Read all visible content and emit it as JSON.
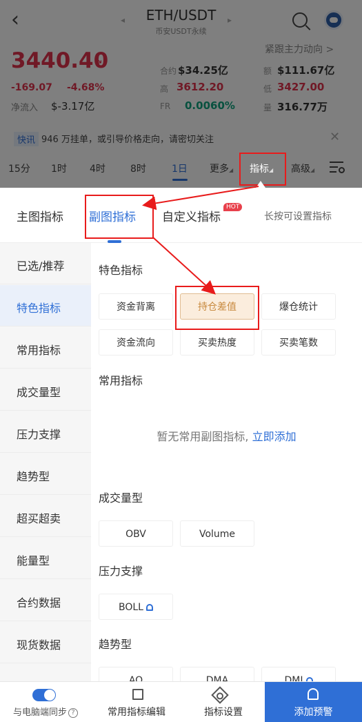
{
  "header": {
    "pair": "ETH/USDT",
    "subtitle": "币安USDT永续",
    "follow_text": "紧跟主力动向 >"
  },
  "ticker": {
    "price": "3440.40",
    "change_abs": "-169.07",
    "change_pct": "-4.68%",
    "net_inflow_label": "净流入",
    "net_inflow_value": "$-3.17亿",
    "stats": [
      {
        "label": "合约",
        "value": "$34.25亿",
        "tone": "normal"
      },
      {
        "label": "额",
        "value": "$111.67亿",
        "tone": "normal"
      },
      {
        "label": "高",
        "value": "3612.20",
        "tone": "red"
      },
      {
        "label": "低",
        "value": "3427.00",
        "tone": "red"
      },
      {
        "label": "FR",
        "value": "0.0060%",
        "tone": "green"
      },
      {
        "label": "量",
        "value": "316.77万",
        "tone": "normal"
      }
    ]
  },
  "news": {
    "tag": "快讯",
    "text": "946 万挂单，或引导价格走向，请密切关注"
  },
  "intervals": [
    "15分",
    "1时",
    "4时",
    "8时",
    "1日",
    "更多",
    "指标",
    "高级"
  ],
  "active_interval": "1日",
  "panel": {
    "tabs": [
      "主图指标",
      "副图指标",
      "自定义指标"
    ],
    "active_tab": "副图指标",
    "hot_badge": "HOT",
    "hint": "长按可设置指标",
    "sidebar": [
      "已选/推荐",
      "特色指标",
      "常用指标",
      "成交量型",
      "压力支撑",
      "趋势型",
      "超买超卖",
      "能量型",
      "合约数据",
      "现货数据"
    ],
    "active_sidebar": "特色指标",
    "sections": {
      "featured": {
        "title": "特色指标",
        "items": [
          "资金背离",
          "持仓差值",
          "爆仓统计",
          "资金流向",
          "买卖热度",
          "买卖笔数"
        ],
        "selected": "持仓差值"
      },
      "common": {
        "title": "常用指标",
        "empty_text": "暂无常用副图指标,",
        "add_link": "立即添加"
      },
      "volume": {
        "title": "成交量型",
        "items": [
          "OBV",
          "Volume"
        ]
      },
      "support": {
        "title": "压力支撑",
        "items": [
          "BOLL"
        ]
      },
      "trend": {
        "title": "趋势型",
        "items": [
          "AO",
          "DMA",
          "DMI"
        ]
      }
    }
  },
  "bottom_bar": {
    "sync_label": "与电脑端同步",
    "edit_label": "常用指标编辑",
    "settings_label": "指标设置",
    "alert_label": "添加预警"
  },
  "colors": {
    "accent": "#2f6fd6",
    "down_red": "#e0334c",
    "highlight_box": "#e81b1b",
    "selected_chip_bg": "#fbeddd"
  }
}
